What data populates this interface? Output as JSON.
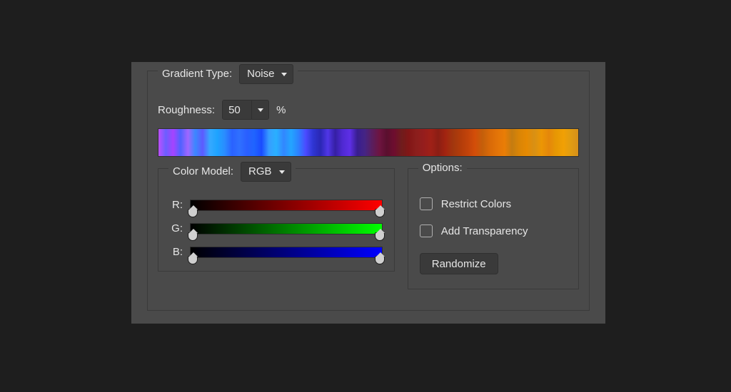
{
  "labels": {
    "gradient_type": "Gradient Type:",
    "roughness": "Roughness:",
    "percent": "%",
    "color_model": "Color Model:",
    "options": "Options:",
    "channel_r": "R:",
    "channel_g": "G:",
    "channel_b": "B:"
  },
  "values": {
    "gradient_type": "Noise",
    "roughness": "50",
    "color_model": "RGB"
  },
  "options": {
    "restrict_colors": {
      "label": "Restrict Colors",
      "checked": false
    },
    "add_transparency": {
      "label": "Add Transparency",
      "checked": false
    },
    "randomize": "Randomize"
  },
  "sliders": {
    "r": {
      "min": 0,
      "max": 255
    },
    "g": {
      "min": 0,
      "max": 255
    },
    "b": {
      "min": 0,
      "max": 255
    }
  }
}
